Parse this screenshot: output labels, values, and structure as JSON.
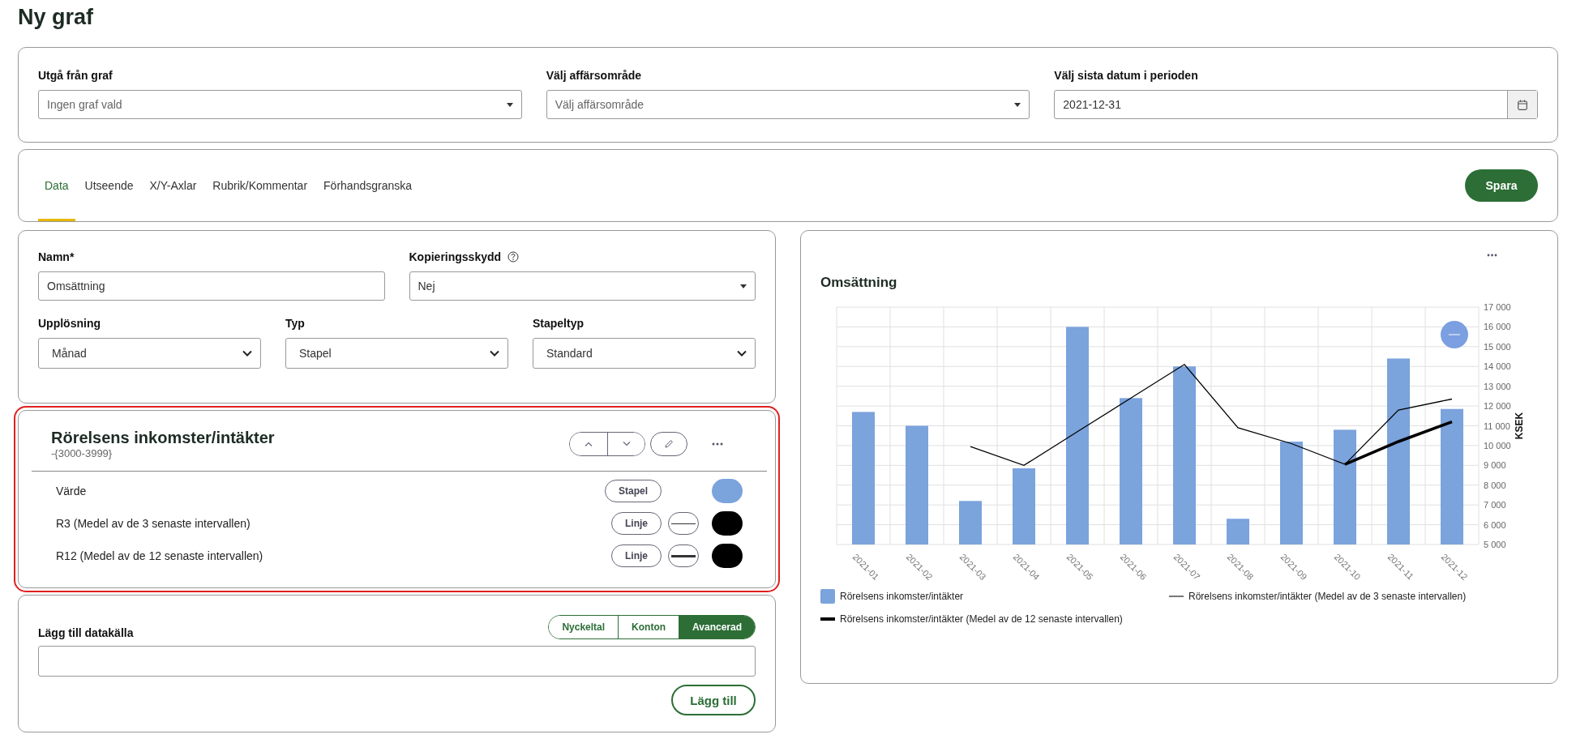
{
  "page_title": "Ny graf",
  "filters": [
    {
      "kind": "dropdown",
      "label": "Utgå från graf",
      "placeholder": "Ingen graf vald"
    },
    {
      "kind": "dropdown",
      "label": "Välj affärsområde",
      "placeholder": "Välj affärsområde"
    },
    {
      "kind": "date",
      "label": "Välj sista datum i perioden",
      "value": "2021-12-31"
    }
  ],
  "tabs": [
    {
      "label": "Data",
      "selected": true
    },
    {
      "label": "Utseende",
      "selected": false
    },
    {
      "label": "X/Y-Axlar",
      "selected": false
    },
    {
      "label": "Rubrik/Kommentar",
      "selected": false
    },
    {
      "label": "Förhandsgranska",
      "selected": false
    }
  ],
  "save_button": "Spara",
  "settings": {
    "name": {
      "label": "Namn*",
      "value": "Omsättning"
    },
    "copy_protection": {
      "label": "Kopieringsskydd",
      "value": "Nej"
    },
    "selects": [
      {
        "label": "Upplösning",
        "value": "Månad"
      },
      {
        "label": "Typ",
        "value": "Stapel"
      },
      {
        "label": "Stapeltyp",
        "value": "Standard"
      }
    ]
  },
  "series_card": {
    "selected": true,
    "title": "Rörelsens inkomster/intäkter",
    "subtitle": "-{3000-3999}",
    "rows": [
      {
        "kind": "bar",
        "label": "Värde",
        "type_button": "Stapel",
        "color": "#7ba3dc"
      },
      {
        "kind": "line",
        "label": "R3 (Medel av de 3 senaste intervallen)",
        "type_button": "Linje",
        "thick": false,
        "color": "#000000"
      },
      {
        "kind": "line",
        "label": "R12 (Medel av de 12 senaste intervallen)",
        "type_button": "Linje",
        "thick": true,
        "color": "#000000"
      }
    ]
  },
  "add_source": {
    "label": "Lägg till datakälla",
    "modes": [
      {
        "label": "Nyckeltal",
        "selected": false
      },
      {
        "label": "Konton",
        "selected": false
      },
      {
        "label": "Avancerad",
        "selected": true
      }
    ],
    "button": "Lägg till"
  },
  "chart": {
    "title": "Omsättning",
    "chart_data": {
      "type": "bar",
      "ylabel": "KSEK",
      "categories": [
        "2021-01",
        "2021-02",
        "2021-03",
        "2021-04",
        "2021-05",
        "2021-06",
        "2021-07",
        "2021-08",
        "2021-09",
        "2021-10",
        "2021-11",
        "2021-12"
      ],
      "series": [
        {
          "name": "Rörelsens inkomster/intäkter",
          "color": "#7ba3dc",
          "values": [
            11700,
            11000,
            7200,
            8850,
            16000,
            12400,
            14000,
            6300,
            10200,
            10800,
            14400,
            11850
          ]
        },
        {
          "name": "Rörelsens inkomster/intäkter (Medel av de 3 senaste intervallen)",
          "type": "line",
          "color": "#000000",
          "values": [
            null,
            null,
            9950,
            9000,
            10700,
            12400,
            14100,
            10900,
            10100,
            9050,
            11800,
            12350
          ]
        },
        {
          "name": "Rörelsens inkomster/intäkter (Medel av de 12 senaste intervallen)",
          "type": "line",
          "color": "#000000",
          "values": [
            null,
            null,
            null,
            null,
            null,
            null,
            null,
            null,
            null,
            9050,
            10200,
            11200
          ]
        }
      ],
      "ylim": [
        5000,
        17000
      ],
      "grid": true,
      "yticks": [
        {
          "value": 5000,
          "label": "5 000"
        },
        {
          "value": 6000,
          "label": "6 000"
        },
        {
          "value": 7000,
          "label": "7 000"
        },
        {
          "value": 8000,
          "label": "8 000"
        },
        {
          "value": 9000,
          "label": "9 000"
        },
        {
          "value": 10000,
          "label": "10 000"
        },
        {
          "value": 11000,
          "label": "11 000"
        },
        {
          "value": 12000,
          "label": "12 000"
        },
        {
          "value": 13000,
          "label": "13 000"
        },
        {
          "value": 14000,
          "label": "14 000"
        },
        {
          "value": 15000,
          "label": "15 000"
        },
        {
          "value": 16000,
          "label": "16 000"
        },
        {
          "value": 17000,
          "label": "17 000"
        }
      ]
    }
  }
}
